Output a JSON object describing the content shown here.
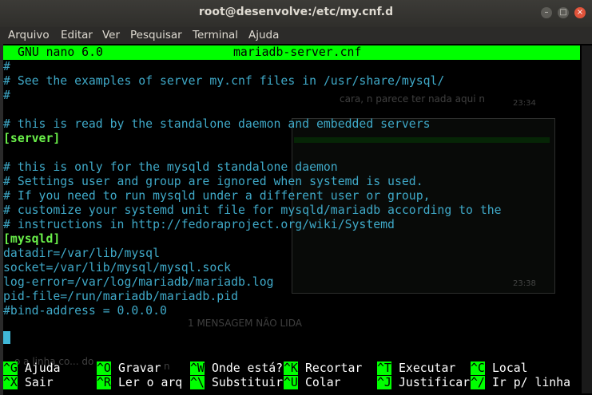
{
  "window": {
    "title": "root@desenvolve:/etc/my.cnf.d",
    "controls": {
      "minimize": "–",
      "maximize": "□",
      "close": "×"
    }
  },
  "menu": [
    "Arquivo",
    "Editar",
    "Ver",
    "Pesquisar",
    "Terminal",
    "Ajuda"
  ],
  "nano": {
    "version": "GNU nano 6.0",
    "filename": "mariadb-server.cnf"
  },
  "lines": [
    {
      "text": "#",
      "kind": "comment"
    },
    {
      "text": "# See the examples of server my.cnf files in /usr/share/mysql/",
      "kind": "comment"
    },
    {
      "text": "#",
      "kind": "comment"
    },
    {
      "text": "",
      "kind": "blank"
    },
    {
      "text": "# this is read by the standalone daemon and embedded servers",
      "kind": "comment"
    },
    {
      "text": "[server]",
      "kind": "section"
    },
    {
      "text": "",
      "kind": "blank"
    },
    {
      "text": "# this is only for the mysqld standalone daemon",
      "kind": "comment"
    },
    {
      "text": "# Settings user and group are ignored when systemd is used.",
      "kind": "comment"
    },
    {
      "text": "# If you need to run mysqld under a different user or group,",
      "kind": "comment"
    },
    {
      "text": "# customize your systemd unit file for mysqld/mariadb according to the",
      "kind": "comment"
    },
    {
      "text": "# instructions in http://fedoraproject.org/wiki/Systemd",
      "kind": "comment"
    },
    {
      "text": "[mysqld]",
      "kind": "section"
    },
    {
      "text": "datadir=/var/lib/mysql",
      "kind": "config"
    },
    {
      "text": "socket=/var/lib/mysql/mysql.sock",
      "kind": "config"
    },
    {
      "text": "log-error=/var/log/mariadb/mariadb.log",
      "kind": "config"
    },
    {
      "text": "pid-file=/run/mariadb/mariadb.pid",
      "kind": "config"
    },
    {
      "text": "#bind-address = 0.0.0.0",
      "kind": "comment"
    },
    {
      "text": "",
      "kind": "blank"
    },
    {
      "text": "#",
      "kind": "comment"
    }
  ],
  "shortcuts_row1": [
    {
      "key": "^G",
      "label": "Ajuda"
    },
    {
      "key": "^O",
      "label": "Gravar"
    },
    {
      "key": "^W",
      "label": "Onde está?"
    },
    {
      "key": "^K",
      "label": "Recortar"
    },
    {
      "key": "^T",
      "label": "Executar"
    },
    {
      "key": "^C",
      "label": "Local"
    }
  ],
  "shortcuts_row2": [
    {
      "key": "^X",
      "label": "Sair"
    },
    {
      "key": "^R",
      "label": "Ler o arq"
    },
    {
      "key": "^\\",
      "label": "Substituir"
    },
    {
      "key": "^U",
      "label": "Colar"
    },
    {
      "key": "^J",
      "label": "Justificar"
    },
    {
      "key": "^/",
      "label": "Ir p/ linha"
    }
  ],
  "overlay": {
    "chat_message": "cara, n parece ter nada aqui n",
    "chat_time": "23:34",
    "ghost_time": "23:38",
    "unread": "1 MENSAGEM NÃO LIDA",
    "bottom_text": "o a linha co... do",
    "bottom_text2": "n"
  },
  "colors": {
    "accent": "#00ff00",
    "comment": "#3fa9c8",
    "section": "#6af04a"
  }
}
